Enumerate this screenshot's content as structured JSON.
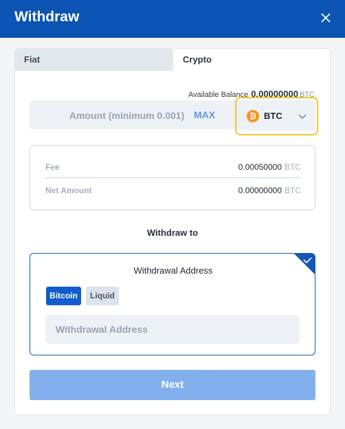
{
  "header": {
    "title": "Withdraw",
    "close_icon": "close-icon"
  },
  "tabs": [
    {
      "label": "Fiat",
      "active": false
    },
    {
      "label": "Crypto",
      "active": true
    }
  ],
  "balance": {
    "label": "Available Balance",
    "value": "0.00000000",
    "currency": "BTC"
  },
  "amount": {
    "placeholder": "Amount (minimum 0.001)",
    "max_label": "MAX"
  },
  "coin_select": {
    "selected": "BTC",
    "icon": "bitcoin-icon",
    "icon_glyph": "₿",
    "highlight_color": "#f3c425"
  },
  "fees": {
    "fee": {
      "label": "Fee",
      "value": "0.00050000",
      "currency": "BTC"
    },
    "net": {
      "label": "Net Amount",
      "value": "0.00000000",
      "currency": "BTC"
    }
  },
  "withdraw_to": {
    "label": "Withdraw to"
  },
  "address_card": {
    "title": "Withdrawal Address",
    "networks": [
      {
        "label": "Bitcoin",
        "selected": true
      },
      {
        "label": "Liquid",
        "selected": false
      }
    ],
    "input_placeholder": "Withdrawal Address",
    "input_value": ""
  },
  "next_button": {
    "label": "Next"
  },
  "colors": {
    "brand": "#0b54b3",
    "accent": "#0f5dcc",
    "button_disabled": "#82b0ec"
  }
}
